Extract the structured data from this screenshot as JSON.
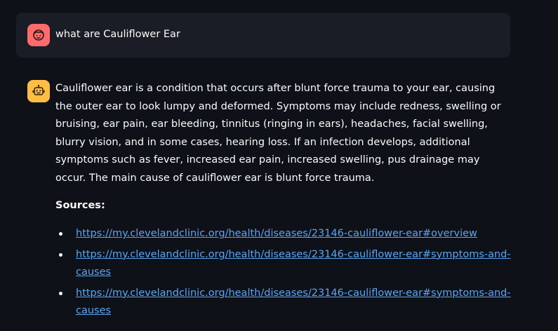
{
  "user_message": {
    "avatar_icon": "user-face-icon",
    "avatar_color": "#ff6b6b",
    "text": "what are Cauliflower Ear"
  },
  "assistant_message": {
    "avatar_icon": "robot-icon",
    "avatar_color": "#ffbd45",
    "answer": "Cauliflower ear is a condition that occurs after blunt force trauma to your ear, causing the outer ear to look lumpy and deformed. Symptoms may include redness, swelling or bruising, ear pain, ear bleeding, tinnitus (ringing in ears), headaches, facial swelling, blurry vision, and in some cases, hearing loss. If an infection develops, additional symptoms such as fever, increased ear pain, increased swelling, pus drainage may occur. The main cause of cauliflower ear is blunt force trauma.",
    "sources_label": "Sources:",
    "sources": [
      "https://my.clevelandclinic.org/health/diseases/23146-cauliflower-ear#overview",
      "https://my.clevelandclinic.org/health/diseases/23146-cauliflower-ear#symptoms-and-causes",
      "https://my.clevelandclinic.org/health/diseases/23146-cauliflower-ear#symptoms-and-causes"
    ]
  },
  "colors": {
    "background": "#0e1117",
    "user_bubble": "#1b1d26",
    "link": "#5ba4f3"
  }
}
